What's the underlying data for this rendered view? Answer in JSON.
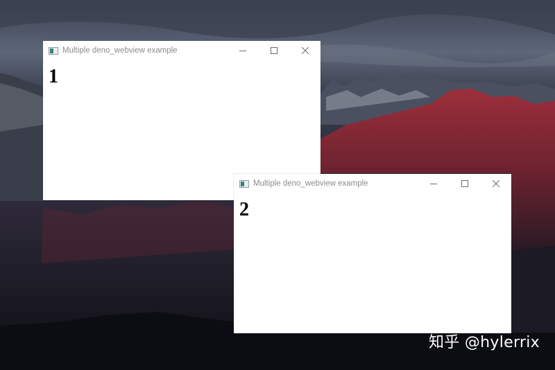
{
  "desktop": {
    "watermark": "知乎 @hylerrix"
  },
  "windows": [
    {
      "title": "Multiple deno_webview example",
      "heading": "1"
    },
    {
      "title": "Multiple deno_webview example",
      "heading": "2"
    }
  ],
  "icons": {
    "app": "webview-app-icon",
    "minimize": "minimize-icon",
    "maximize": "maximize-icon",
    "close": "close-icon"
  },
  "colors": {
    "title_text": "#8c8c8c",
    "window_bg": "#ffffff",
    "mountain_red": "#8a2a36"
  }
}
